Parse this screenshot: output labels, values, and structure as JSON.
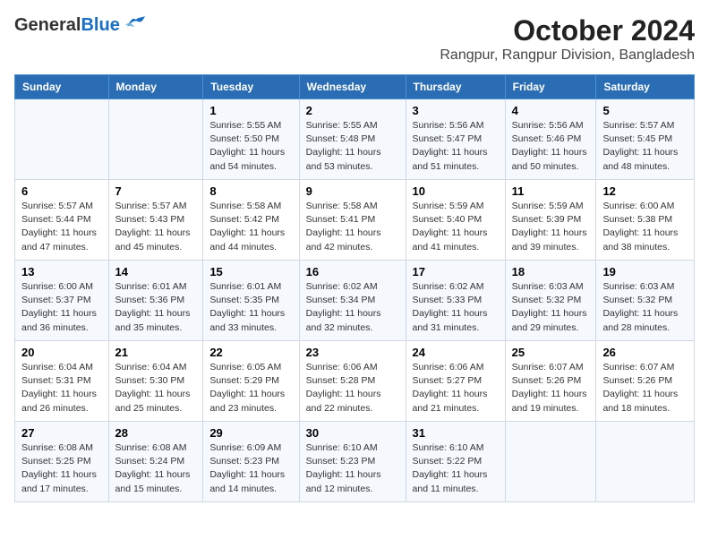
{
  "logo": {
    "general": "General",
    "blue": "Blue"
  },
  "title": "October 2024",
  "subtitle": "Rangpur, Rangpur Division, Bangladesh",
  "days_of_week": [
    "Sunday",
    "Monday",
    "Tuesday",
    "Wednesday",
    "Thursday",
    "Friday",
    "Saturday"
  ],
  "weeks": [
    [
      {
        "day": "",
        "info": ""
      },
      {
        "day": "",
        "info": ""
      },
      {
        "day": "1",
        "info": "Sunrise: 5:55 AM\nSunset: 5:50 PM\nDaylight: 11 hours and 54 minutes."
      },
      {
        "day": "2",
        "info": "Sunrise: 5:55 AM\nSunset: 5:48 PM\nDaylight: 11 hours and 53 minutes."
      },
      {
        "day": "3",
        "info": "Sunrise: 5:56 AM\nSunset: 5:47 PM\nDaylight: 11 hours and 51 minutes."
      },
      {
        "day": "4",
        "info": "Sunrise: 5:56 AM\nSunset: 5:46 PM\nDaylight: 11 hours and 50 minutes."
      },
      {
        "day": "5",
        "info": "Sunrise: 5:57 AM\nSunset: 5:45 PM\nDaylight: 11 hours and 48 minutes."
      }
    ],
    [
      {
        "day": "6",
        "info": "Sunrise: 5:57 AM\nSunset: 5:44 PM\nDaylight: 11 hours and 47 minutes."
      },
      {
        "day": "7",
        "info": "Sunrise: 5:57 AM\nSunset: 5:43 PM\nDaylight: 11 hours and 45 minutes."
      },
      {
        "day": "8",
        "info": "Sunrise: 5:58 AM\nSunset: 5:42 PM\nDaylight: 11 hours and 44 minutes."
      },
      {
        "day": "9",
        "info": "Sunrise: 5:58 AM\nSunset: 5:41 PM\nDaylight: 11 hours and 42 minutes."
      },
      {
        "day": "10",
        "info": "Sunrise: 5:59 AM\nSunset: 5:40 PM\nDaylight: 11 hours and 41 minutes."
      },
      {
        "day": "11",
        "info": "Sunrise: 5:59 AM\nSunset: 5:39 PM\nDaylight: 11 hours and 39 minutes."
      },
      {
        "day": "12",
        "info": "Sunrise: 6:00 AM\nSunset: 5:38 PM\nDaylight: 11 hours and 38 minutes."
      }
    ],
    [
      {
        "day": "13",
        "info": "Sunrise: 6:00 AM\nSunset: 5:37 PM\nDaylight: 11 hours and 36 minutes."
      },
      {
        "day": "14",
        "info": "Sunrise: 6:01 AM\nSunset: 5:36 PM\nDaylight: 11 hours and 35 minutes."
      },
      {
        "day": "15",
        "info": "Sunrise: 6:01 AM\nSunset: 5:35 PM\nDaylight: 11 hours and 33 minutes."
      },
      {
        "day": "16",
        "info": "Sunrise: 6:02 AM\nSunset: 5:34 PM\nDaylight: 11 hours and 32 minutes."
      },
      {
        "day": "17",
        "info": "Sunrise: 6:02 AM\nSunset: 5:33 PM\nDaylight: 11 hours and 31 minutes."
      },
      {
        "day": "18",
        "info": "Sunrise: 6:03 AM\nSunset: 5:32 PM\nDaylight: 11 hours and 29 minutes."
      },
      {
        "day": "19",
        "info": "Sunrise: 6:03 AM\nSunset: 5:32 PM\nDaylight: 11 hours and 28 minutes."
      }
    ],
    [
      {
        "day": "20",
        "info": "Sunrise: 6:04 AM\nSunset: 5:31 PM\nDaylight: 11 hours and 26 minutes."
      },
      {
        "day": "21",
        "info": "Sunrise: 6:04 AM\nSunset: 5:30 PM\nDaylight: 11 hours and 25 minutes."
      },
      {
        "day": "22",
        "info": "Sunrise: 6:05 AM\nSunset: 5:29 PM\nDaylight: 11 hours and 23 minutes."
      },
      {
        "day": "23",
        "info": "Sunrise: 6:06 AM\nSunset: 5:28 PM\nDaylight: 11 hours and 22 minutes."
      },
      {
        "day": "24",
        "info": "Sunrise: 6:06 AM\nSunset: 5:27 PM\nDaylight: 11 hours and 21 minutes."
      },
      {
        "day": "25",
        "info": "Sunrise: 6:07 AM\nSunset: 5:26 PM\nDaylight: 11 hours and 19 minutes."
      },
      {
        "day": "26",
        "info": "Sunrise: 6:07 AM\nSunset: 5:26 PM\nDaylight: 11 hours and 18 minutes."
      }
    ],
    [
      {
        "day": "27",
        "info": "Sunrise: 6:08 AM\nSunset: 5:25 PM\nDaylight: 11 hours and 17 minutes."
      },
      {
        "day": "28",
        "info": "Sunrise: 6:08 AM\nSunset: 5:24 PM\nDaylight: 11 hours and 15 minutes."
      },
      {
        "day": "29",
        "info": "Sunrise: 6:09 AM\nSunset: 5:23 PM\nDaylight: 11 hours and 14 minutes."
      },
      {
        "day": "30",
        "info": "Sunrise: 6:10 AM\nSunset: 5:23 PM\nDaylight: 11 hours and 12 minutes."
      },
      {
        "day": "31",
        "info": "Sunrise: 6:10 AM\nSunset: 5:22 PM\nDaylight: 11 hours and 11 minutes."
      },
      {
        "day": "",
        "info": ""
      },
      {
        "day": "",
        "info": ""
      }
    ]
  ]
}
